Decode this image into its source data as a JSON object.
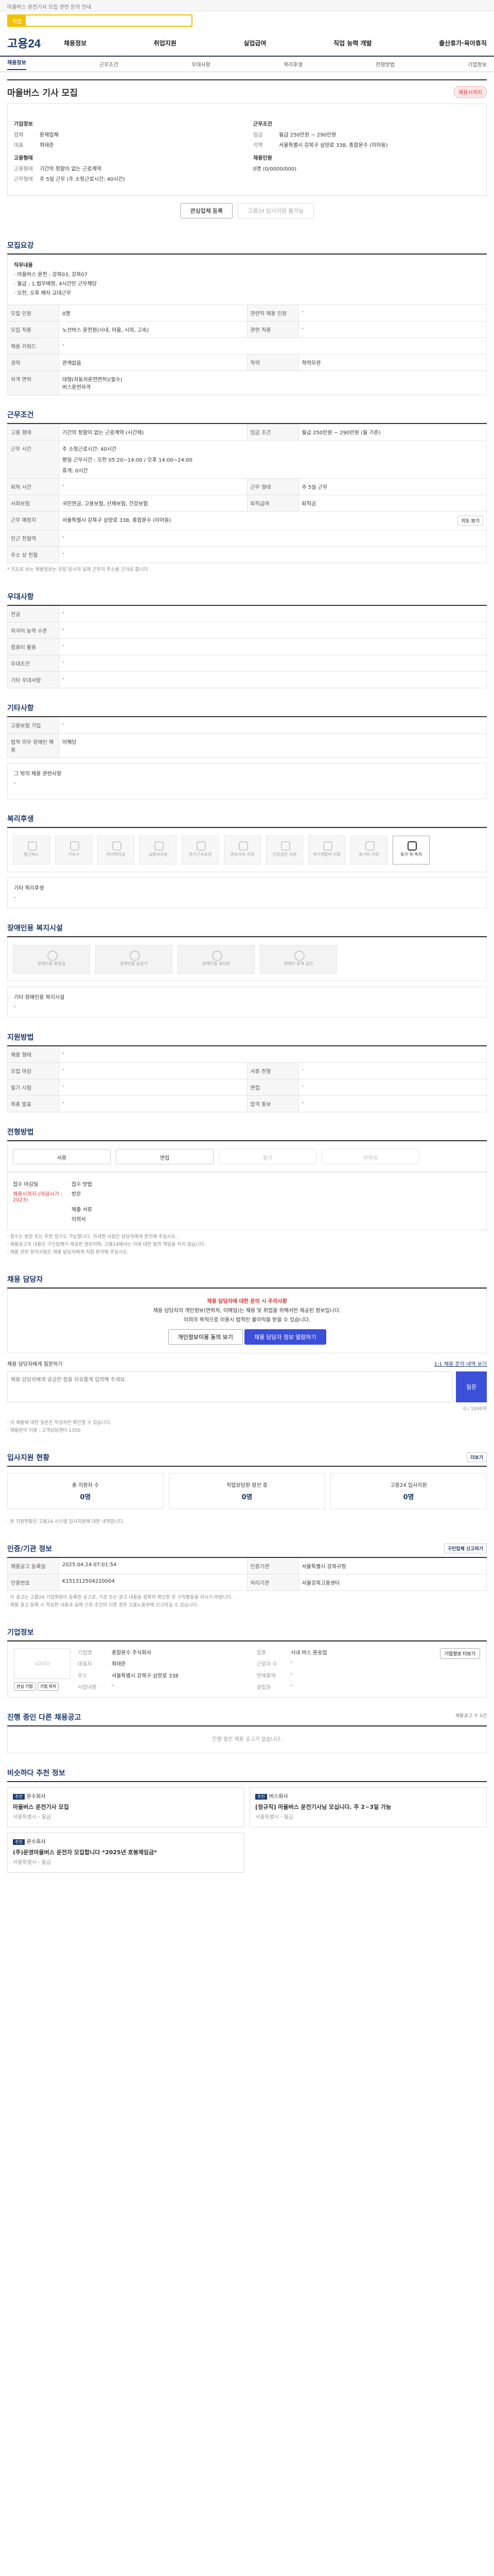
{
  "notice": "마을버스 운전기사 모집 관련 문의 안내",
  "search": {
    "label": "직업",
    "placeholder": ""
  },
  "brand": {
    "logo": "고용24"
  },
  "gnb": [
    "채용정보",
    "취업지원",
    "실업급여",
    "직업 능력 개발",
    "출산휴가·육아휴직"
  ],
  "subnav": [
    "채용정보",
    "근무조건",
    "우대사항",
    "복리후생",
    "전형방법",
    "기업정보"
  ],
  "title": "마을버스 기사 모집",
  "status_badge": "채용시까지",
  "summary": {
    "company_h": "기업정보",
    "company": [
      [
        "업체",
        "운제업체"
      ],
      [
        "대표",
        "최태준"
      ]
    ],
    "work_h": "근무조건",
    "work": [
      [
        "임금",
        "월급 250만원 ~ 290만원"
      ],
      [
        "지역",
        "서울특별시 강북구 삼양로 338, 종합운수 (미아동)"
      ]
    ],
    "cond_h": "고용형태",
    "cond": [
      [
        "고용형태",
        "기간의 정함이 없는 근로계약"
      ],
      [
        "근무형태",
        "주 5일 근무 (주 소정근로시간: 40시간)"
      ]
    ],
    "apply_h": "채용인원",
    "apply": "0명 (0/0000/000)"
  },
  "buttons": {
    "interest": "관심업체 등록",
    "apply": "고용24 입사지원 불가능"
  },
  "recruit": {
    "h": "모집요강",
    "career_h": "직무내용",
    "career": [
      "· 마을버스 운전 : 강북03, 강북07",
      "· 월급 : 1.법무배정, 4시간만 근무해당",
      "· 오전, 오후 배차 교대근무"
    ],
    "rows": [
      [
        "모집 인원",
        "0명",
        "관련직 채용 인원",
        "-"
      ],
      [
        "모집 직종",
        "노선버스 운전원(시내, 마을, 시외, 고속)",
        "관련 직종",
        "-"
      ],
      [
        "채용 키워드",
        "-",
        "",
        ""
      ],
      [
        "경력",
        "관계없음",
        "학력",
        "학력무관"
      ],
      [
        "자격 면허",
        "대형(자동차운전면허)(필수)",
        "",
        ""
      ]
    ],
    "license2": "버스운전자격"
  },
  "workcond": {
    "h": "근무조건",
    "rows": [
      [
        "고용 형태",
        "기간의 정함이 없는 근로계약 (시간제)",
        "임금 조건",
        "월급 250만원 ~ 290만원 (월 기준)"
      ],
      [
        "근무 시간",
        "주 소정근로시간: 40시간",
        "",
        ""
      ],
      [
        "근무 시간2",
        "평일 근무시간 : 오전 05:20~14:00 / 오후 14:00~24:00",
        "",
        ""
      ],
      [
        "휴게",
        "휴게: 0시간",
        "",
        ""
      ],
      [
        "퇴직 시간",
        "-",
        "근무 형태",
        "주 5일 근무"
      ],
      [
        "사회보험",
        "국민연금, 고용보험, 산재보험, 건강보험",
        "퇴직급여",
        "퇴직금"
      ],
      [
        "근무 예정지",
        "서울특별시 강북구 삼양로 338, 종합운수 (미아동)",
        "",
        ""
      ],
      [
        "인근 전철역",
        "-",
        "",
        ""
      ],
      [
        "주소 상 전철",
        "-",
        "",
        ""
      ]
    ],
    "map_btn": "지도 보기",
    "note": "* 지도로 보는 채용정보는 모집 당시의 실제 근무지 주소를 근거로 합니다."
  },
  "prefer": {
    "h": "우대사항",
    "rows": [
      [
        "전공",
        "-"
      ],
      [
        "외국어 능력 수준",
        "-"
      ],
      [
        "컴퓨터 활용",
        "-"
      ],
      [
        "우대조건",
        "-"
      ],
      [
        "기타 우대사항",
        "-"
      ]
    ]
  },
  "other": {
    "h": "기타사항",
    "rows": [
      [
        "고용보험 가입",
        "-"
      ],
      [
        "법적 의무 장애인 채용",
        "미해당"
      ]
    ],
    "box_title": "그 밖의 채용 관련사항",
    "box_val": "-"
  },
  "welfare": {
    "h": "복리후생",
    "items": [
      "통근버스",
      "기숙사",
      "자녀학자금",
      "교통비지원",
      "장기근속포상",
      "경조사비 지원",
      "건강검진 지원",
      "자기계발비 지원",
      "휴가비 지원",
      "휴가 외 복지"
    ],
    "extra_h": "기타 복리후생",
    "extra_v": "-"
  },
  "disabled": {
    "h": "장애인용 복지시설",
    "items": [
      "장애인용 화장실",
      "장애인용 승강기",
      "장애인용 경사로",
      "장애인 휴게 공간"
    ],
    "extra_h": "기타 장애인용 복지시설",
    "extra_v": "-"
  },
  "process": {
    "h": "지원방법",
    "rows": [
      [
        "채용 형태",
        "-",
        "",
        ""
      ],
      [
        "모집 마감",
        "-",
        "서류 전형",
        "-"
      ],
      [
        "필기 시험",
        "-",
        "면접",
        "-"
      ],
      [
        "최종 발표",
        "-",
        "합격 통보",
        "-"
      ]
    ]
  },
  "method": {
    "h": "전형방법",
    "steps": [
      "서류",
      "면접",
      "필기",
      "인적성"
    ]
  },
  "contact": {
    "h1": "접수 마감일",
    "v1": "채용시까지 (마감시기 : 2023)",
    "h2": "접수 방법",
    "v2": "방문",
    "h3": "제출 서류",
    "v3": "이력서",
    "notes": [
      "· 접수는 방문 또는 우편 접수도 가능합니다. 자세한 사항은 담당자에게 문의해 주십시오.",
      "· 채용공고의 내용은 구인업체가 제공한 정보이며, 고용24에서는 이에 대한 법적 책임을 지지 않습니다.",
      "· 채용 관련 문의사항은 채용 담당자에게 직접 문의해 주십시오."
    ]
  },
  "manager": {
    "h": "채용 담당자",
    "warn_title": "채용 담당자에 대한 문의 시 주의사항",
    "warn_lines": [
      "채용 담당자의 개인정보(연락처, 이메일)는 채용 및 취업을 위해서만 제공된 정보입니다.",
      "이외의 목적으로 이용시 법적인 불이익을 받을 수 있습니다."
    ],
    "btn1": "개인정보이용 동의 보기",
    "btn2": "채용 담당자 정보 열람하기"
  },
  "inquiry": {
    "h": "채용 담당자에게 질문하기",
    "link": "1:1 채용 문의 내역 보기",
    "placeholder": "채용 담당자에게 궁금한 점을 자유롭게 입력해 주세요.",
    "counter": "0 / 1000자",
    "submit": "질문",
    "notes": [
      "· 이 채용에 대한 질문은 작성자만 확인할 수 있습니다.",
      "· 채용문의 이용 : 고객상담센터 1350"
    ]
  },
  "applicants": {
    "h": "입사지원 현황",
    "more": "더보기",
    "stats": [
      [
        "총 지원자 수",
        "0명"
      ],
      [
        "직업상담원 알선 중",
        "0명"
      ],
      [
        "고용24 입사지원",
        "0명"
      ]
    ],
    "note": "· 본 지원현황은 고용24 시스템 입사지원에 대한 내역입니다."
  },
  "info": {
    "h": "인증/기관 정보",
    "btn": "구인업체 신고하기",
    "rows": [
      [
        "채용공고 등록일",
        "2025.04.24 07:01:54",
        "인증기관",
        "서울특별시 강북구청"
      ],
      [
        "인증번호",
        "K151312504220004",
        "처리기관",
        "서울강북고용센터"
      ]
    ],
    "notes": [
      "· 이 공고는 고용24 기업회원이 등록한 공고로, 기관 또는 공고 내용을 정확히 확인한 후 구직활동을 하시기 바랍니다.",
      "· 채용 공고 등록 시 작성한 내용과 실제 근로 조건이 다른 경우 고용노동부에 신고하실 수 있습니다."
    ]
  },
  "company": {
    "h": "기업정보",
    "btn": "기업정보 더보기",
    "logo": "LOGO",
    "actions": [
      "관심 기업",
      "기업 위치"
    ],
    "rows": [
      [
        "기업명",
        "종합운수 주식회사",
        "업종",
        "시내 버스 운송업"
      ],
      [
        "대표자",
        "최태준",
        "근로자 수",
        "-"
      ],
      [
        "주소",
        "서울특별시 강북구 삼양로 338",
        "연매출액",
        "-"
      ],
      [
        "사업내용",
        "-",
        "설립일",
        "-"
      ]
    ]
  },
  "related": {
    "h": "진행 중인 다른 채용공고",
    "count": "채용공고 수 0건",
    "empty": "진행 중인 채용 공고가 없습니다."
  },
  "recommend": {
    "h": "비슷하다 추천 정보",
    "items": [
      {
        "tag": "추천",
        "co": "운수회사",
        "title": "마을버스 운전기사 모집",
        "a": "서울특별시",
        "b": "월급"
      },
      {
        "tag": "추천",
        "co": "버스회사",
        "title": "[정규직] 마을버스 운전기사님 모십니다. 주 2~3일 가능",
        "a": "서울특별시",
        "b": "월급"
      },
      {
        "tag": "추천",
        "co": "운수회사",
        "title": "(주)운영마을버스 운전자 모집합니다 *2025년 호봉제임금*",
        "a": "서울특별시",
        "b": "월급"
      }
    ]
  }
}
